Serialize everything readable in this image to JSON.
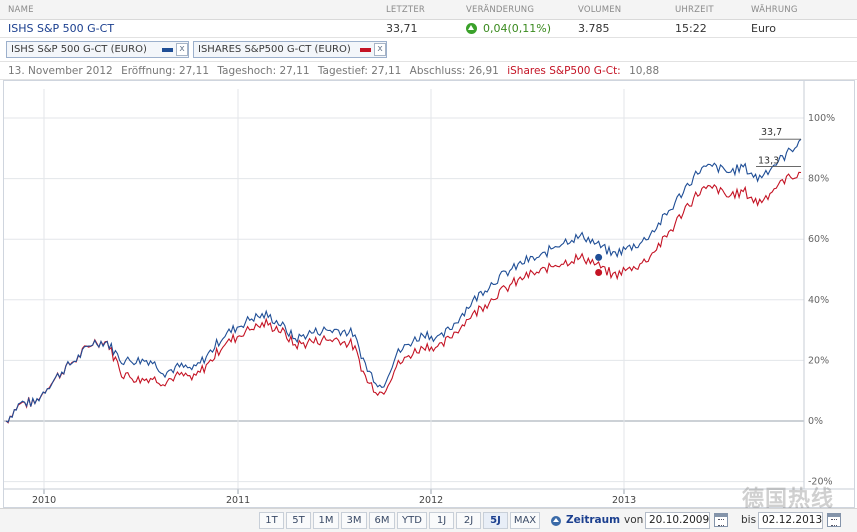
{
  "header": {
    "name": "NAME",
    "last": "LETZTER",
    "change": "VERÄNDERUNG",
    "volume": "VOLUMEN",
    "time": "UHRZEIT",
    "currency": "WÄHRUNG"
  },
  "quote": {
    "name": "ISHS S&P 500 G-CT",
    "last": "33,71",
    "change": "0,04(0,11%)",
    "volume": "3.785",
    "time": "15:22",
    "currency": "Euro",
    "change_icon": "up-arrow-icon",
    "change_color": "#3a8a1e"
  },
  "comparison_tags": [
    {
      "label": "ISHS S&P 500 G-CT (EURO)",
      "color": "#1f4e96",
      "close": "x"
    },
    {
      "label": "ISHARES S&P500 G-CT (EURO)",
      "color": "#c41324",
      "close": "x"
    }
  ],
  "info_line": {
    "date": "13. November 2012",
    "open": "Eröffnung: 27,11",
    "high": "Tageshoch: 27,11",
    "low": "Tagestief: 27,11",
    "close": "Abschluss: 26,91",
    "compare_label": "iShares S&P500 G-Ct:",
    "compare_value": "10,88"
  },
  "chart_data": {
    "type": "line",
    "x_ticks": [
      "2010",
      "2011",
      "2012",
      "2013"
    ],
    "y_ticks": [
      "100%",
      "80%",
      "60%",
      "40%",
      "20%",
      "0%",
      "-20%"
    ],
    "ylim": [
      -20,
      100
    ],
    "series": [
      {
        "name": "ISHS S&P 500 G-CT (EURO)",
        "color": "#1f4e96",
        "end_label": "33,7",
        "values": [
          0,
          6,
          6,
          12,
          17,
          21,
          26,
          26,
          20,
          20,
          20,
          16,
          18,
          17,
          22,
          28,
          31,
          34,
          35,
          32,
          27,
          29,
          30,
          30,
          29,
          17,
          11,
          22,
          26,
          29,
          27,
          32,
          38,
          43,
          47,
          50,
          53,
          54,
          58,
          60,
          61,
          58,
          55,
          57,
          59,
          64,
          70,
          77,
          83,
          84,
          82,
          84,
          80,
          84,
          88,
          93
        ]
      },
      {
        "name": "ISHARES S&P500 G-CT (EURO)",
        "color": "#c41324",
        "end_label": "13,3",
        "values": [
          0,
          6,
          6,
          12,
          17,
          21,
          26,
          26,
          16,
          14,
          14,
          13,
          15,
          14,
          19,
          25,
          28,
          31,
          32,
          30,
          25,
          26,
          27,
          27,
          25,
          13,
          9,
          18,
          22,
          25,
          24,
          29,
          34,
          38,
          42,
          45,
          48,
          49,
          52,
          53,
          54,
          51,
          48,
          50,
          52,
          57,
          63,
          70,
          76,
          77,
          74,
          76,
          72,
          76,
          80,
          82
        ]
      }
    ],
    "markers": [
      {
        "series": 0,
        "index": 41,
        "value": 54
      },
      {
        "series": 1,
        "index": 41,
        "value": 49
      }
    ],
    "grid": true,
    "axis_position": "right"
  },
  "toolbar": {
    "ranges": [
      "1T",
      "5T",
      "1M",
      "3M",
      "6M",
      "YTD",
      "1J",
      "2J",
      "5J",
      "MAX"
    ],
    "active_range": "5J",
    "period_label": "Zeitraum",
    "from_label": "von",
    "from_date": "20.10.2009",
    "to_label": "bis",
    "to_date": "02.12.2013"
  },
  "watermark": "德国热线"
}
